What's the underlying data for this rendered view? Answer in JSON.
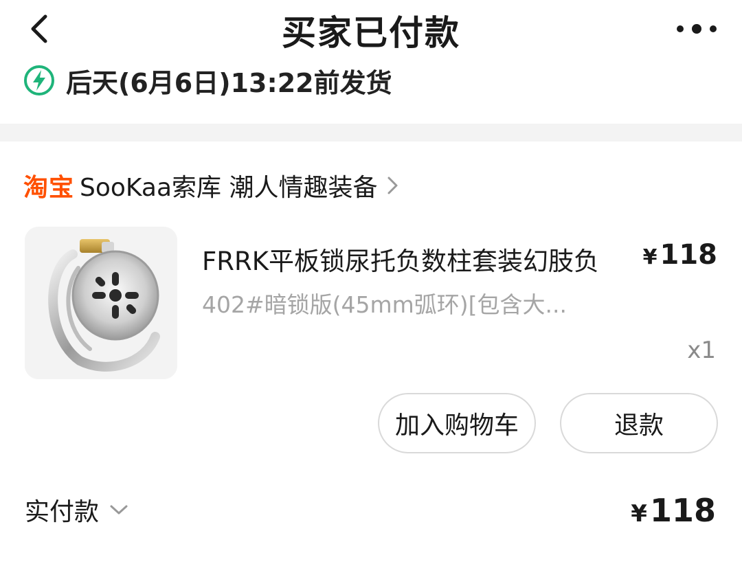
{
  "header": {
    "title": "买家已付款"
  },
  "shipping": {
    "text": "后天(6月6日)13:22前发货",
    "icon": "lightning-circle-icon",
    "accent_color": "#1fb47a"
  },
  "shop": {
    "platform_logo": "淘宝",
    "platform_color": "#ff5000",
    "name": "SooKaa索库 潮人情趣装备"
  },
  "product": {
    "title": "FRRK平板锁尿托负数柱套装幻肢负",
    "price_symbol": "¥",
    "price": "118",
    "spec": "402#暗锁版(45mm弧环)[包含大...",
    "quantity": "x1"
  },
  "actions": {
    "add_to_cart": "加入购物车",
    "refund": "退款"
  },
  "payment": {
    "label": "实付款",
    "symbol": "¥",
    "amount": "118"
  }
}
